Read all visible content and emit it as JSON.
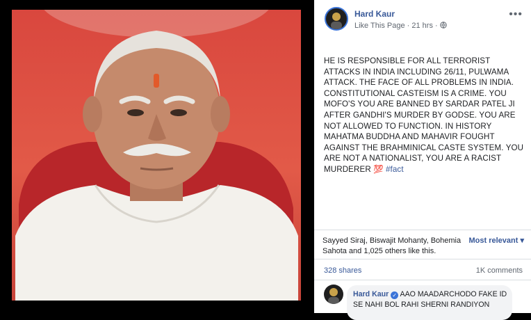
{
  "post": {
    "author": "Hard Kaur",
    "like_link": "Like This Page",
    "separator": "·",
    "time": "21 hrs",
    "separator2": "·",
    "privacy_icon": "globe-icon",
    "more_icon": "•••",
    "text": "HE IS RESPONSIBLE FOR ALL TERRORIST ATTACKS IN INDIA INCLUDING 26/11, PULWAMA ATTACK. THE FACE OF ALL PROBLEMS IN INDIA. CONSTITUTIONAL CASTEISM IS A CRIME. YOU MOFO'S YOU ARE BANNED BY SARDAR PATEL JI AFTER GANDHI'S MURDER BY GODSE. YOU ARE NOT ALLOWED TO FUNCTION. IN HISTORY MAHATMA BUDDHA AND MAHAVIR FOUGHT AGAINST THE BRAHMINICAL CASTE SYSTEM. YOU ARE NOT A NATIONALIST, YOU ARE A RACIST MURDERER",
    "emoji": "💯",
    "hashtag": "#fact"
  },
  "engagement": {
    "likes_text": "Sayyed Siraj, Biswajit Mohanty, Bohemia Sahota and 1,025 others like this.",
    "sort_label": "Most relevant",
    "sort_icon": "▾",
    "shares": "328 shares",
    "comments": "1K comments"
  },
  "comment": {
    "author": "Hard Kaur",
    "verified_icon": "✓",
    "text": "AAO MAADARCHODO FAKE ID SE NAHI BOL RAHI SHERNI RANDIYON"
  },
  "colors": {
    "link": "#385898",
    "photo_background": "#d9473e"
  }
}
